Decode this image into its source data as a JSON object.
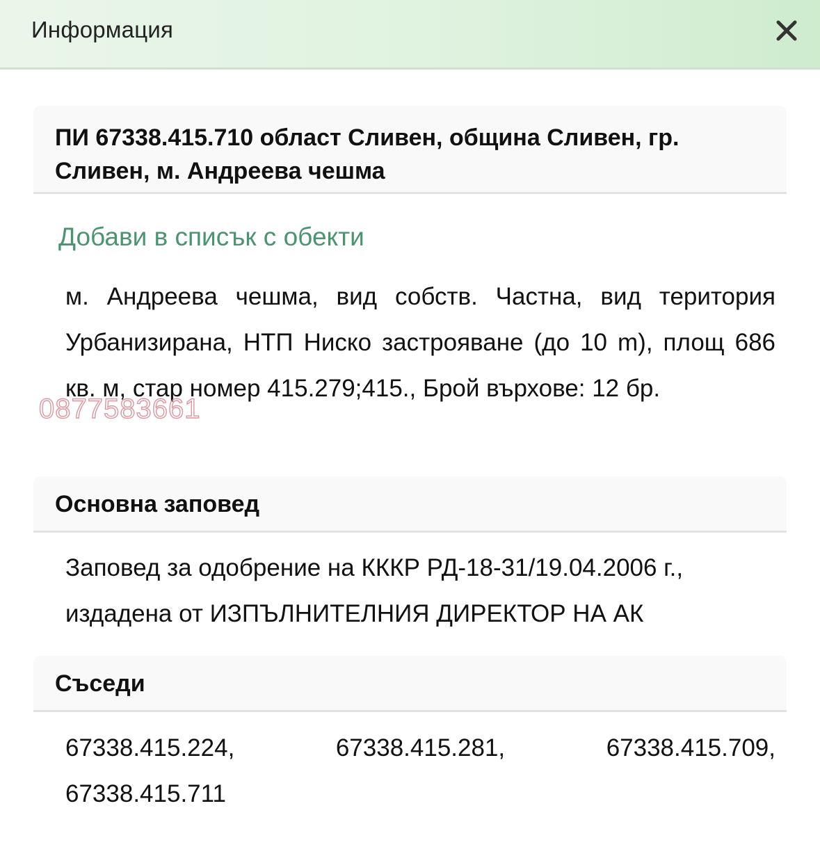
{
  "header": {
    "title": "Информация",
    "close_icon": "close-icon"
  },
  "parcel": {
    "heading": "ПИ 67338.415.710 област Сливен, община Сливен, гр. Сливен, м. Андреева чешма",
    "add_link": "Добави в списък с обекти",
    "description": "м. Андреева чешма, вид собств. Частна, вид територия Урбанизирана, НТП Ниско застрояване (до 10 m), площ 686 кв. м, стар номер 415.279;415., Брой върхове: 12 бр."
  },
  "order": {
    "heading": "Основна заповед",
    "text": "Заповед за одобрение на КККР РД-18-31/19.04.2006 г., издадена от ИЗПЪЛНИТЕЛНИЯ ДИРЕКТОР НА АК"
  },
  "neighbors": {
    "heading": "Съседи",
    "items": [
      "67338.415.224,",
      "67338.415.281,",
      "67338.415.709,",
      "67338.415.711"
    ]
  },
  "watermark": "0877583661",
  "colors": {
    "link": "#4a9470",
    "header_bg": "#dff2df",
    "watermark": "#d98a94"
  }
}
